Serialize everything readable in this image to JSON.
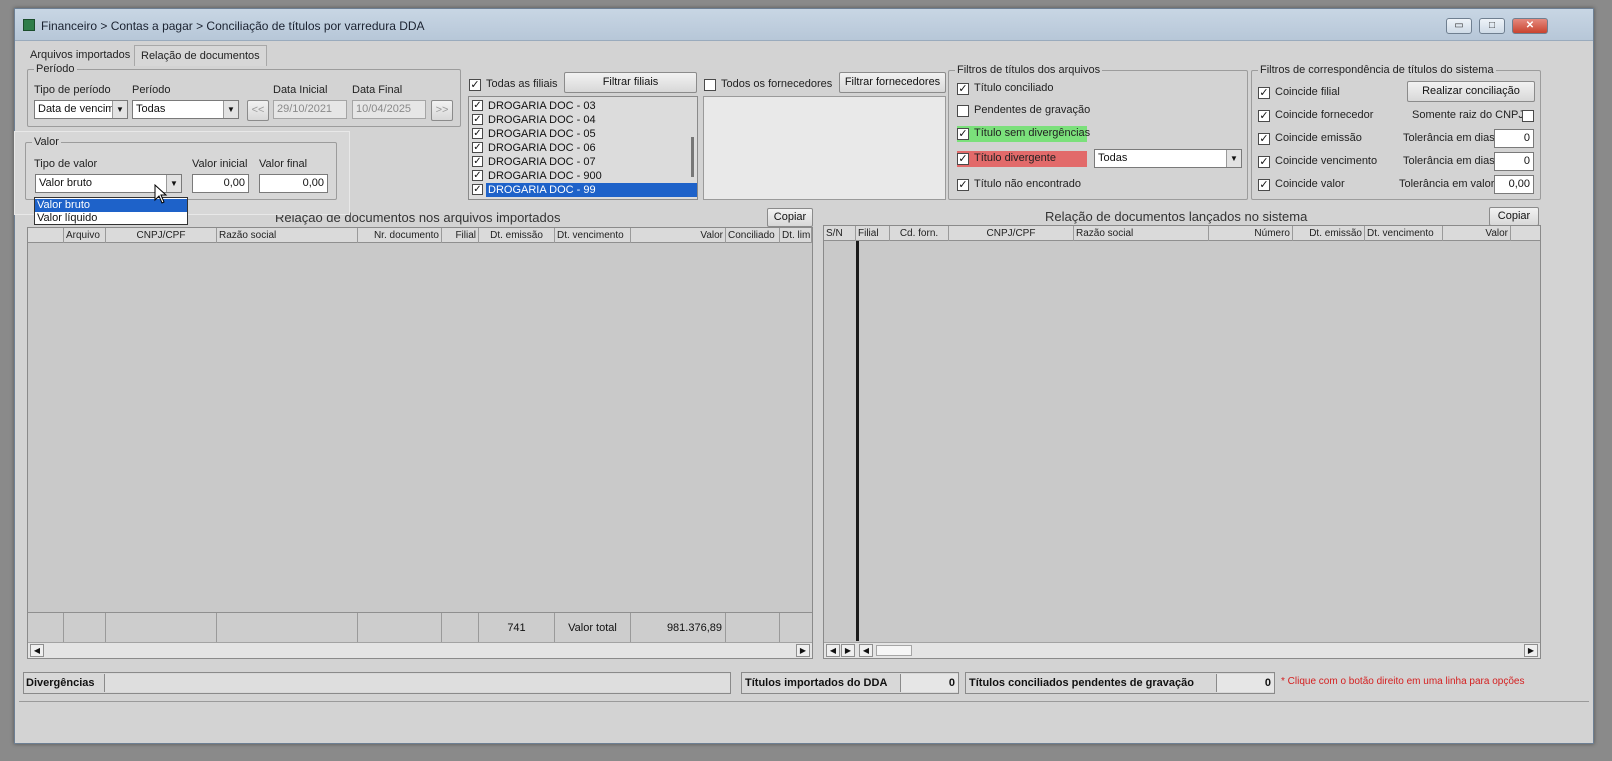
{
  "window": {
    "title": "Financeiro > Contas a pagar > Conciliação de títulos por varredura DDA",
    "controls": {
      "minimize": "▭",
      "maximize": "□",
      "close": "✕"
    }
  },
  "tabs": [
    {
      "label": "Arquivos importados"
    },
    {
      "label": "Relação de documentos"
    }
  ],
  "periodo": {
    "legend": "Período",
    "tipo_label": "Tipo de período",
    "tipo_value": "Data de vencim",
    "periodo_label": "Período",
    "periodo_value": "Todas",
    "prev_btn": "<<",
    "data_inicial_label": "Data Inicial",
    "data_inicial_value": "29/10/2021",
    "data_final_label": "Data Final",
    "data_final_value": "10/04/2025",
    "next_btn": ">>"
  },
  "valor": {
    "legend": "Valor",
    "tipo_label": "Tipo de valor",
    "tipo_value": "Valor bruto",
    "inicial_label": "Valor inicial",
    "inicial_value": "0,00",
    "final_label": "Valor final",
    "final_value": "0,00",
    "options": [
      "Valor bruto",
      "Valor líquido"
    ]
  },
  "filiais": {
    "todas_label": "Todas as filiais",
    "filtrar_btn": "Filtrar filiais",
    "items": [
      "DROGARIA DOC - 03",
      "DROGARIA DOC - 04",
      "DROGARIA DOC - 05",
      "DROGARIA DOC - 06",
      "DROGARIA DOC - 07",
      "DROGARIA DOC - 900",
      "DROGARIA DOC - 99"
    ]
  },
  "fornecedores": {
    "todos_label": "Todos os fornecedores",
    "filtrar_btn": "Filtrar fornecedores"
  },
  "filtros_arquivos": {
    "legend": "Filtros de títulos dos arquivos",
    "items": [
      "Título conciliado",
      "Pendentes de gravação",
      "Título sem divergências",
      "Título divergente",
      "Título não encontrado"
    ],
    "divergente_select": "Todas"
  },
  "filtros_sistema": {
    "legend": "Filtros de correspondência de títulos do sistema",
    "checks": [
      "Coincide filial",
      "Coincide fornecedor",
      "Coincide emissão",
      "Coincide vencimento",
      "Coincide valor"
    ],
    "realizar_btn": "Realizar conciliação",
    "somente_raiz": "Somente raiz do CNPJ",
    "tol_dias_label": "Tolerância em dias",
    "tol_dias_1": "0",
    "tol_dias_2": "0",
    "tol_valor_label": "Tolerância em valor",
    "tol_valor": "0,00"
  },
  "grid_left": {
    "title": "Relação de documentos nos arquivos importados",
    "copy_btn": "Copiar",
    "columns": [
      "",
      "Arquivo",
      "CNPJ/CPF",
      "Razão social",
      "Nr. documento",
      "Filial",
      "Dt. emissão",
      "Dt. vencimento",
      "Valor",
      "Conciliado",
      "Dt. lim"
    ],
    "footer_count": "741",
    "footer_label": "Valor total",
    "footer_total": "981.376,89"
  },
  "grid_right": {
    "title": "Relação de documentos lançados no sistema",
    "copy_btn": "Copiar",
    "columns": [
      "S/N",
      "Filial",
      "Cd. forn.",
      "CNPJ/CPF",
      "Razão social",
      "Número",
      "Dt. emissão",
      "Dt. vencimento",
      "Valor"
    ]
  },
  "status": {
    "divergencias_label": "Divergências",
    "importados_label": "Títulos importados do DDA",
    "importados_value": "0",
    "pendentes_label": "Títulos conciliados pendentes de gravação",
    "pendentes_value": "0",
    "note": "* Clique com o botão direito em uma linha para opções"
  }
}
